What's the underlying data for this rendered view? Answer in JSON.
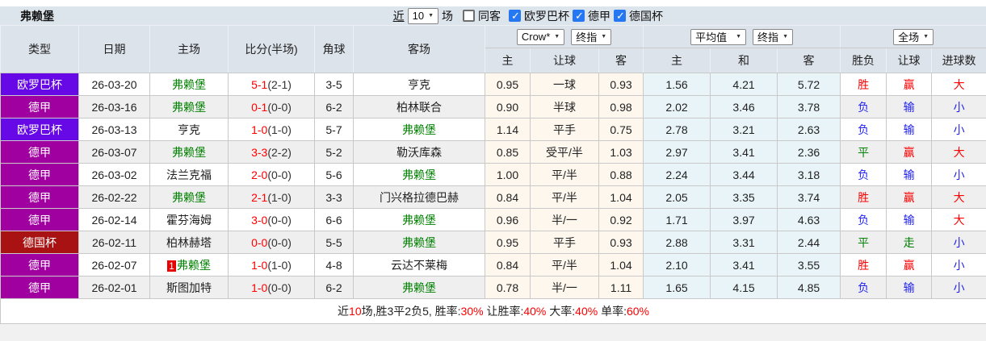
{
  "page": {
    "team_title": "弗赖堡"
  },
  "topbar": {
    "recent_link": "近",
    "recent_value": "10",
    "matches_label": "场",
    "same_away_label": "同客",
    "same_away_checked": false,
    "filters": [
      {
        "label": "欧罗巴杯",
        "checked": true
      },
      {
        "label": "德甲",
        "checked": true
      },
      {
        "label": "德国杯",
        "checked": true
      }
    ]
  },
  "header": {
    "cols": [
      "类型",
      "日期",
      "主场",
      "比分(半场)",
      "角球",
      "客场"
    ],
    "bookmaker_select": "Crow*",
    "bookmaker_index_select": "终指",
    "avg_select": "平均值",
    "avg_index_select": "终指",
    "scope_select": "全场",
    "odds_sub": [
      "主",
      "让球",
      "客"
    ],
    "avg_sub": [
      "主",
      "和",
      "客"
    ],
    "result_sub": [
      "胜负",
      "让球",
      "进球数"
    ]
  },
  "colors": {
    "league_europa": "#6609E6",
    "league_bundesliga": "#A000A0",
    "league_pokal": "#A81212",
    "team_focus": "#008000",
    "score_red": "#FF0000",
    "win_red": "#FF0000",
    "loss_blue": "#2222EE",
    "draw_green": "#008000"
  },
  "rows": [
    {
      "league": "欧罗巴杯",
      "lc": "europa",
      "date": "26-03-20",
      "home": "弗赖堡",
      "home_focus": true,
      "home_badge": "",
      "score": "5-1",
      "half": "(2-1)",
      "corner": "3-5",
      "away": "亨克",
      "away_focus": false,
      "o1": "0.95",
      "line": "一球",
      "o2": "0.93",
      "a1": "1.56",
      "a2": "4.21",
      "a3": "5.72",
      "r1": "胜",
      "r1c": "w",
      "r2": "赢",
      "r2c": "w",
      "r3": "大",
      "r3c": "w"
    },
    {
      "league": "德甲",
      "lc": "bundesliga",
      "date": "26-03-16",
      "home": "弗赖堡",
      "home_focus": true,
      "home_badge": "",
      "score": "0-1",
      "half": "(0-0)",
      "corner": "6-2",
      "away": "柏林联合",
      "away_focus": false,
      "o1": "0.90",
      "line": "半球",
      "o2": "0.98",
      "a1": "2.02",
      "a2": "3.46",
      "a3": "3.78",
      "r1": "负",
      "r1c": "l",
      "r2": "输",
      "r2c": "l",
      "r3": "小",
      "r3c": "l"
    },
    {
      "league": "欧罗巴杯",
      "lc": "europa",
      "date": "26-03-13",
      "home": "亨克",
      "home_focus": false,
      "home_badge": "",
      "score": "1-0",
      "half": "(1-0)",
      "corner": "5-7",
      "away": "弗赖堡",
      "away_focus": true,
      "o1": "1.14",
      "line": "平手",
      "o2": "0.75",
      "a1": "2.78",
      "a2": "3.21",
      "a3": "2.63",
      "r1": "负",
      "r1c": "l",
      "r2": "输",
      "r2c": "l",
      "r3": "小",
      "r3c": "l"
    },
    {
      "league": "德甲",
      "lc": "bundesliga",
      "date": "26-03-07",
      "home": "弗赖堡",
      "home_focus": true,
      "home_badge": "",
      "score": "3-3",
      "half": "(2-2)",
      "corner": "5-2",
      "away": "勒沃库森",
      "away_focus": false,
      "o1": "0.85",
      "line": "受平/半",
      "o2": "1.03",
      "a1": "2.97",
      "a2": "3.41",
      "a3": "2.36",
      "r1": "平",
      "r1c": "d",
      "r2": "赢",
      "r2c": "w",
      "r3": "大",
      "r3c": "w"
    },
    {
      "league": "德甲",
      "lc": "bundesliga",
      "date": "26-03-02",
      "home": "法兰克福",
      "home_focus": false,
      "home_badge": "",
      "score": "2-0",
      "half": "(0-0)",
      "corner": "5-6",
      "away": "弗赖堡",
      "away_focus": true,
      "o1": "1.00",
      "line": "平/半",
      "o2": "0.88",
      "a1": "2.24",
      "a2": "3.44",
      "a3": "3.18",
      "r1": "负",
      "r1c": "l",
      "r2": "输",
      "r2c": "l",
      "r3": "小",
      "r3c": "l"
    },
    {
      "league": "德甲",
      "lc": "bundesliga",
      "date": "26-02-22",
      "home": "弗赖堡",
      "home_focus": true,
      "home_badge": "",
      "score": "2-1",
      "half": "(1-0)",
      "corner": "3-3",
      "away": "门兴格拉德巴赫",
      "away_focus": false,
      "o1": "0.84",
      "line": "平/半",
      "o2": "1.04",
      "a1": "2.05",
      "a2": "3.35",
      "a3": "3.74",
      "r1": "胜",
      "r1c": "w",
      "r2": "赢",
      "r2c": "w",
      "r3": "大",
      "r3c": "w"
    },
    {
      "league": "德甲",
      "lc": "bundesliga",
      "date": "26-02-14",
      "home": "霍芬海姆",
      "home_focus": false,
      "home_badge": "",
      "score": "3-0",
      "half": "(0-0)",
      "corner": "6-6",
      "away": "弗赖堡",
      "away_focus": true,
      "o1": "0.96",
      "line": "半/一",
      "o2": "0.92",
      "a1": "1.71",
      "a2": "3.97",
      "a3": "4.63",
      "r1": "负",
      "r1c": "l",
      "r2": "输",
      "r2c": "l",
      "r3": "大",
      "r3c": "w"
    },
    {
      "league": "德国杯",
      "lc": "pokal",
      "date": "26-02-11",
      "home": "柏林赫塔",
      "home_focus": false,
      "home_badge": "",
      "score": "0-0",
      "half": "(0-0)",
      "corner": "5-5",
      "away": "弗赖堡",
      "away_focus": true,
      "o1": "0.95",
      "line": "平手",
      "o2": "0.93",
      "a1": "2.88",
      "a2": "3.31",
      "a3": "2.44",
      "r1": "平",
      "r1c": "d",
      "r2": "走",
      "r2c": "d",
      "r3": "小",
      "r3c": "l"
    },
    {
      "league": "德甲",
      "lc": "bundesliga",
      "date": "26-02-07",
      "home": "弗赖堡",
      "home_focus": true,
      "home_badge": "1",
      "score": "1-0",
      "half": "(1-0)",
      "corner": "4-8",
      "away": "云达不莱梅",
      "away_focus": false,
      "o1": "0.84",
      "line": "平/半",
      "o2": "1.04",
      "a1": "2.10",
      "a2": "3.41",
      "a3": "3.55",
      "r1": "胜",
      "r1c": "w",
      "r2": "赢",
      "r2c": "w",
      "r3": "小",
      "r3c": "l"
    },
    {
      "league": "德甲",
      "lc": "bundesliga",
      "date": "26-02-01",
      "home": "斯图加特",
      "home_focus": false,
      "home_badge": "",
      "score": "1-0",
      "half": "(0-0)",
      "corner": "6-2",
      "away": "弗赖堡",
      "away_focus": true,
      "o1": "0.78",
      "line": "半/一",
      "o2": "1.11",
      "a1": "1.65",
      "a2": "4.15",
      "a3": "4.85",
      "r1": "负",
      "r1c": "l",
      "r2": "输",
      "r2c": "l",
      "r3": "小",
      "r3c": "l"
    }
  ],
  "footer": {
    "parts": [
      {
        "t": "近",
        "red": false
      },
      {
        "t": "10",
        "red": true
      },
      {
        "t": "场,胜3平2负5, 胜率:",
        "red": false
      },
      {
        "t": "30%",
        "red": true
      },
      {
        "t": " 让胜率:",
        "red": false
      },
      {
        "t": "40%",
        "red": true
      },
      {
        "t": " 大率:",
        "red": false
      },
      {
        "t": "40%",
        "red": true
      },
      {
        "t": " 单率:",
        "red": false
      },
      {
        "t": "60%",
        "red": true
      }
    ]
  }
}
